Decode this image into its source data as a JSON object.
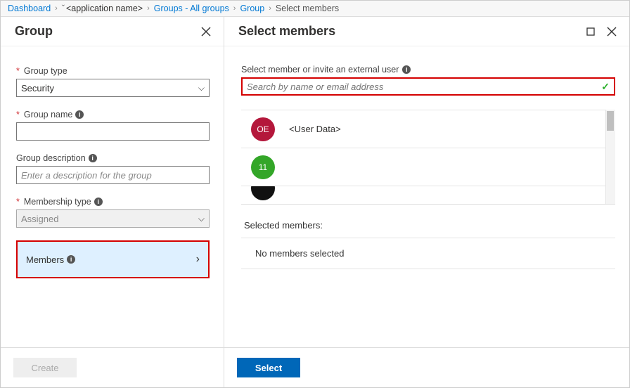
{
  "breadcrumb": {
    "dashboard": "Dashboard",
    "app_name": "<application name>",
    "groups": "Groups - All groups",
    "group": "Group",
    "current": "Select members"
  },
  "left": {
    "title": "Group",
    "group_type": {
      "label": "Group type",
      "value": "Security"
    },
    "group_name": {
      "label": "Group name",
      "value": ""
    },
    "group_desc": {
      "label": "Group description",
      "placeholder": "Enter a description for the group",
      "value": ""
    },
    "membership_type": {
      "label": "Membership type",
      "value": "Assigned"
    },
    "members": {
      "label": "Members"
    },
    "create_btn": "Create"
  },
  "right": {
    "title": "Select members",
    "search_label": "Select member or invite an external user",
    "search_placeholder": "Search by name or email address",
    "items": [
      {
        "initials": "OE",
        "name": "<User Data>",
        "color": "red"
      },
      {
        "initials": "11",
        "name": "",
        "color": "green"
      },
      {
        "initials": "",
        "name": "",
        "color": "black"
      }
    ],
    "selected_label": "Selected members:",
    "no_selected": "No members selected",
    "select_btn": "Select"
  }
}
